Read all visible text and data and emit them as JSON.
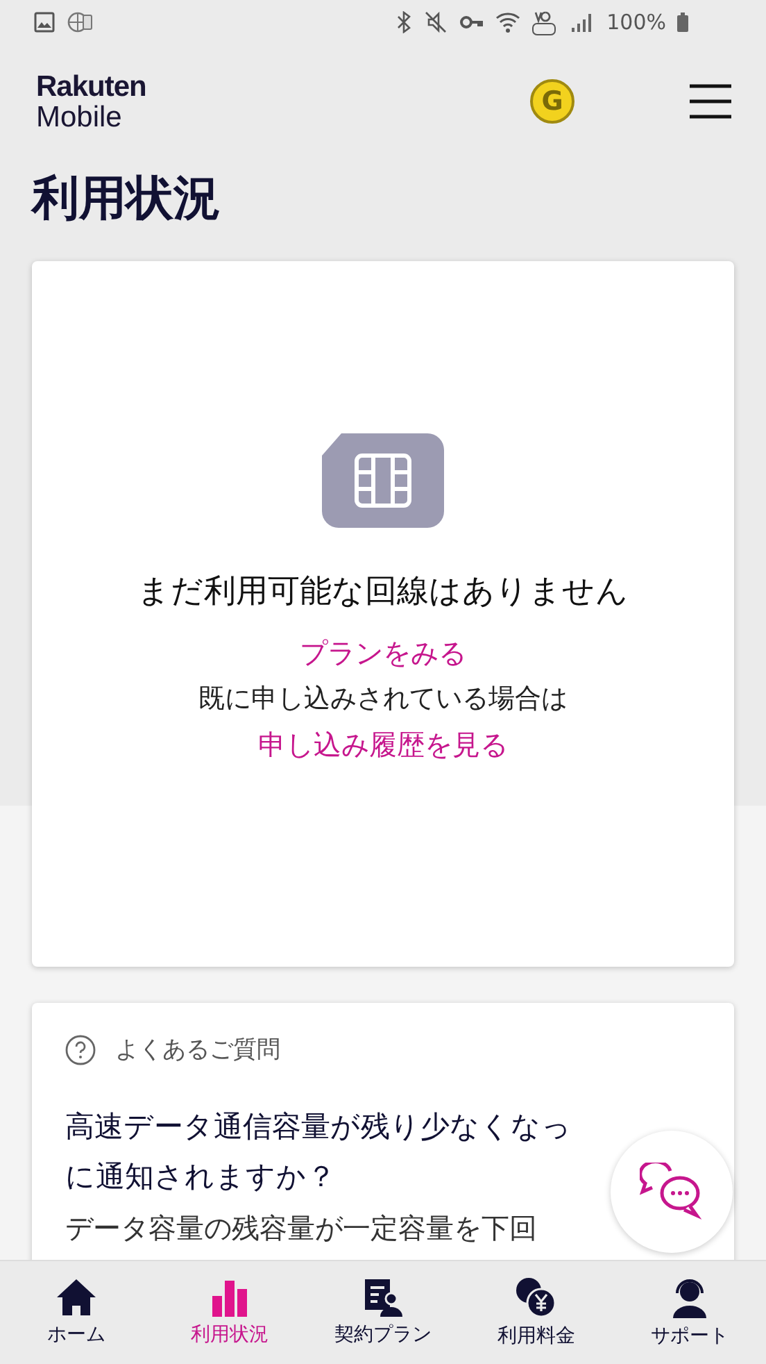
{
  "status_bar": {
    "battery": "100%"
  },
  "header": {
    "logo_top": "Rakuten",
    "logo_bottom": "Mobile",
    "coin": "G"
  },
  "page_title": "利用状況",
  "empty_card": {
    "message": "まだ利用可能な回線はありません",
    "plan_link": "プランをみる",
    "note": "既に申し込みされている場合は",
    "history_link": "申し込み履歴を見る"
  },
  "faq": {
    "heading": "よくあるご質問",
    "question_lines": [
      "高速データ通信容量が残り少なくなっ",
      "に通知されますか？"
    ],
    "answer_line": "データ容量の残容量が一定容量を下回"
  },
  "nav": [
    {
      "kind": "home",
      "label": "ホーム",
      "selected": false
    },
    {
      "kind": "usage",
      "label": "利用状況",
      "selected": true
    },
    {
      "kind": "plan",
      "label": "契約プラン",
      "selected": false
    },
    {
      "kind": "fee",
      "label": "利用料金",
      "selected": false
    },
    {
      "kind": "support",
      "label": "サポート",
      "selected": false
    }
  ]
}
